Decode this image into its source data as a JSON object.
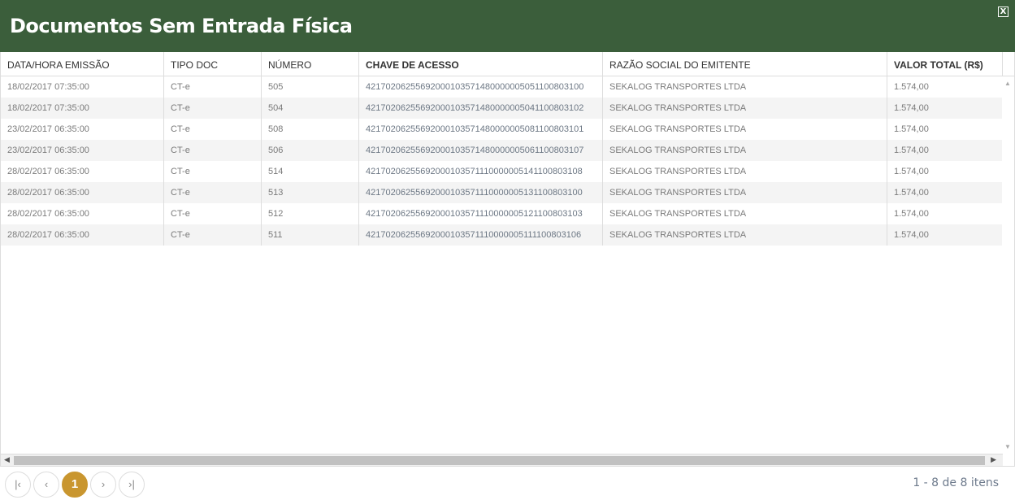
{
  "window": {
    "title": "Documentos Sem Entrada Física",
    "close_icon": "close-icon"
  },
  "table": {
    "columns": [
      "DATA/HORA EMISSÃO",
      "TIPO DOC",
      "NÚMERO",
      "CHAVE DE ACESSO",
      "RAZÃO SOCIAL DO EMITENTE",
      "VALOR TOTAL (R$)"
    ],
    "rows": [
      [
        "18/02/2017 07:35:00",
        "CT-e",
        "505",
        "42170206255692000103571480000005051100803100",
        "SEKALOG TRANSPORTES LTDA",
        "1.574,00"
      ],
      [
        "18/02/2017 07:35:00",
        "CT-e",
        "504",
        "42170206255692000103571480000005041100803102",
        "SEKALOG TRANSPORTES LTDA",
        "1.574,00"
      ],
      [
        "23/02/2017 06:35:00",
        "CT-e",
        "508",
        "42170206255692000103571480000005081100803101",
        "SEKALOG TRANSPORTES LTDA",
        "1.574,00"
      ],
      [
        "23/02/2017 06:35:00",
        "CT-e",
        "506",
        "42170206255692000103571480000005061100803107",
        "SEKALOG TRANSPORTES LTDA",
        "1.574,00"
      ],
      [
        "28/02/2017 06:35:00",
        "CT-e",
        "514",
        "42170206255692000103571110000005141100803108",
        "SEKALOG TRANSPORTES LTDA",
        "1.574,00"
      ],
      [
        "28/02/2017 06:35:00",
        "CT-e",
        "513",
        "42170206255692000103571110000005131100803100",
        "SEKALOG TRANSPORTES LTDA",
        "1.574,00"
      ],
      [
        "28/02/2017 06:35:00",
        "CT-e",
        "512",
        "42170206255692000103571110000005121100803103",
        "SEKALOG TRANSPORTES LTDA",
        "1.574,00"
      ],
      [
        "28/02/2017 06:35:00",
        "CT-e",
        "511",
        "42170206255692000103571110000005111100803106",
        "SEKALOG TRANSPORTES LTDA",
        "1.574,00"
      ]
    ]
  },
  "pager": {
    "first": "|‹",
    "prev": "‹",
    "current": "1",
    "next": "›",
    "last": "›|",
    "info": "1 - 8 de 8 itens"
  },
  "colors": {
    "header": "#3b5e3b",
    "active_page": "#c9962f"
  }
}
